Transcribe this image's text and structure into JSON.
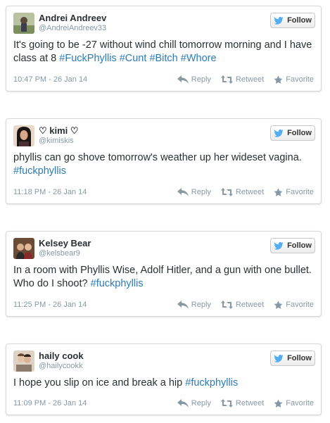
{
  "follow_label": "Follow",
  "actions": {
    "reply": "Reply",
    "retweet": "Retweet",
    "favorite": "Favorite"
  },
  "tweets": [
    {
      "name": "Andrei Andreev",
      "handle": "@AndreiAndreev33",
      "text_plain": "It's going to be -27 without wind chill tomorrow morning and I have class at 8 ",
      "hashtags": [
        "#FuckPhyllis",
        "#Cunt",
        "#Bitch",
        "#Whore"
      ],
      "time": "10:47 PM - 26 Jan 14"
    },
    {
      "name": "♡ kimi ♡",
      "handle": "@kimiskis",
      "text_plain": "phyllis can go shove tomorrow's weather up her wideset vagina. ",
      "hashtags": [
        "#fuckphyllis"
      ],
      "time": "11:18 PM - 26 Jan 14"
    },
    {
      "name": "Kelsey Bear",
      "handle": "@kelsbear9",
      "text_plain": "In a room with Phyllis Wise, Adolf Hitler, and a gun with one bullet. Who do I shoot? ",
      "hashtags": [
        "#fuckphyllis"
      ],
      "time": "11:25 PM - 26 Jan 14"
    },
    {
      "name": "haily cook",
      "handle": "@hailycookk",
      "text_plain": "I hope you slip on ice and break a hip ",
      "hashtags": [
        "#fuckphyllis"
      ],
      "time": "11:09 PM - 26 Jan 14"
    }
  ],
  "colors": {
    "link": "#2b7bb9",
    "meta": "#8899a6",
    "bird": "#55acee"
  },
  "icons": [
    "avatar",
    "twitter-bird-icon",
    "reply-icon",
    "retweet-icon",
    "favorite-star-icon"
  ]
}
